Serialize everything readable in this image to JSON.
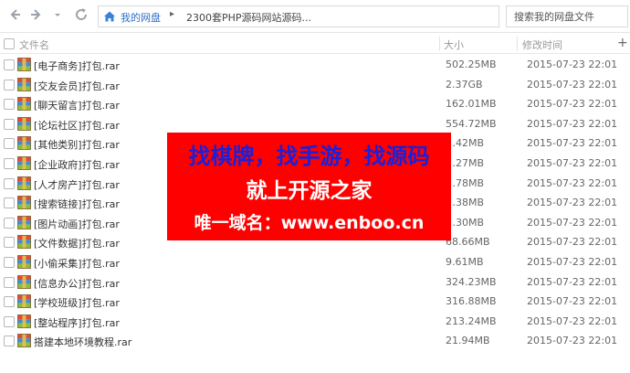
{
  "nav": {
    "back_icon": "arrow-left-icon",
    "forward_icon": "arrow-right-icon",
    "history_icon": "chevron-down-icon",
    "refresh_icon": "refresh-icon",
    "breadcrumb": {
      "home_label": "我的网盘",
      "separator": "▸",
      "current": "2300套PHP源码网站源码..."
    },
    "search_placeholder": "搜索我的网盘文件"
  },
  "header": {
    "name_label": "文件名",
    "size_label": "大小",
    "date_label": "修改时间",
    "add_column": "+"
  },
  "files": [
    {
      "name": "[电子商务]打包.rar",
      "size": "502.25MB",
      "date": "2015-07-23 22:01"
    },
    {
      "name": "[交友会员]打包.rar",
      "size": "2.37GB",
      "date": "2015-07-23 22:01"
    },
    {
      "name": "[聊天留言]打包.rar",
      "size": "162.01MB",
      "date": "2015-07-23 22:01"
    },
    {
      "name": "[论坛社区]打包.rar",
      "size": "554.72MB",
      "date": "2015-07-23 22:01"
    },
    {
      "name": "[其他类别]打包.rar",
      "size": "…42MB",
      "date": "2015-07-23 22:01"
    },
    {
      "name": "[企业政府]打包.rar",
      "size": "…27MB",
      "date": "2015-07-23 22:01"
    },
    {
      "name": "[人才房产]打包.rar",
      "size": "…78MB",
      "date": "2015-07-23 22:01"
    },
    {
      "name": "[搜索链接]打包.rar",
      "size": "…38MB",
      "date": "2015-07-23 22:01"
    },
    {
      "name": "[图片动画]打包.rar",
      "size": "…30MB",
      "date": "2015-07-23 22:01"
    },
    {
      "name": "[文件数据]打包.rar",
      "size": "68.66MB",
      "date": "2015-07-23 22:01"
    },
    {
      "name": "[小偷采集]打包.rar",
      "size": "9.61MB",
      "date": "2015-07-23 22:01"
    },
    {
      "name": "[信息办公]打包.rar",
      "size": "324.23MB",
      "date": "2015-07-23 22:01"
    },
    {
      "name": "[学校班级]打包.rar",
      "size": "316.88MB",
      "date": "2015-07-23 22:01"
    },
    {
      "name": "[整站程序]打包.rar",
      "size": "213.24MB",
      "date": "2015-07-23 22:01"
    },
    {
      "name": "搭建本地环境教程.rar",
      "size": "21.94MB",
      "date": "2015-07-23 22:01"
    }
  ],
  "banner": {
    "line1": "找棋牌，找手游，找源码",
    "line2": "就上开源之家",
    "line3": "唯一域名：www.enboo.cn"
  },
  "colors": {
    "banner_bg": "#ff0000",
    "banner_line1": "#1b20d9",
    "link": "#2f6fc4"
  }
}
